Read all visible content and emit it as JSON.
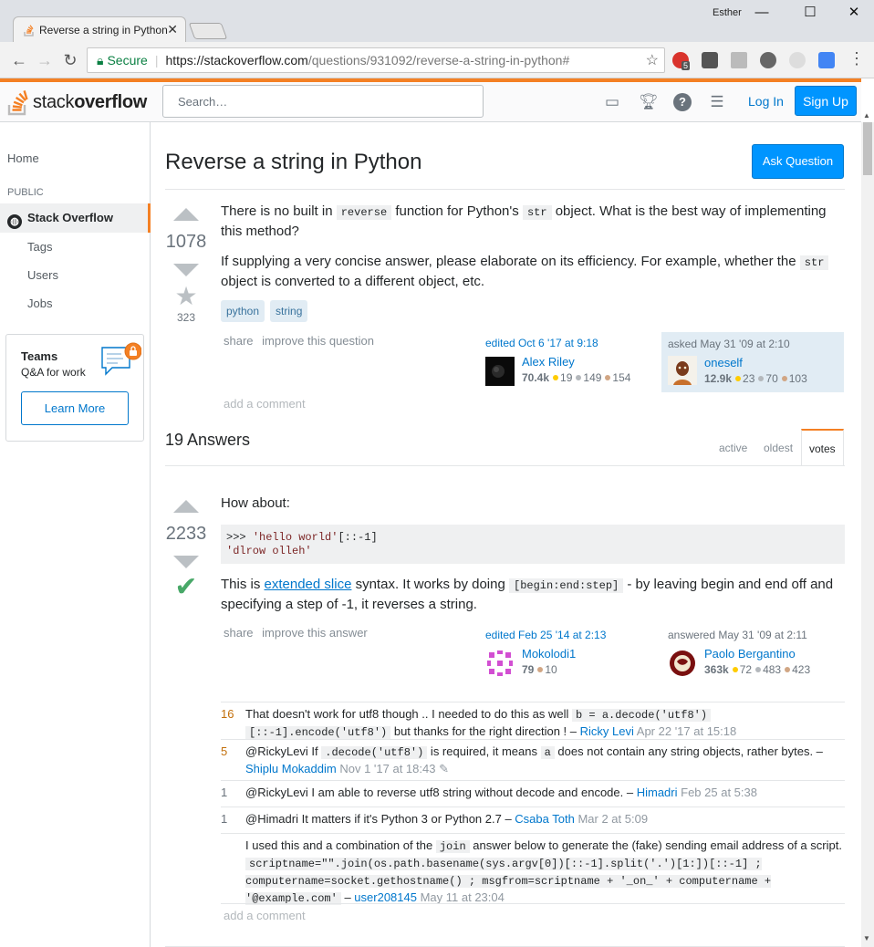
{
  "browser": {
    "tab_title": "Reverse a string in Python",
    "user": "Esther",
    "url_secure": "Secure",
    "url_host": "https://stackoverflow.com",
    "url_path": "/questions/931092/reverse-a-string-in-python#",
    "ext_badge": "5"
  },
  "header": {
    "logo_word_light": "stack",
    "logo_word_bold": "overflow",
    "search_placeholder": "Search…",
    "login": "Log In",
    "signup": "Sign Up"
  },
  "leftnav": {
    "home": "Home",
    "public": "PUBLIC",
    "stackoverflow": "Stack Overflow",
    "tags": "Tags",
    "users": "Users",
    "jobs": "Jobs",
    "teams_title": "Teams",
    "teams_sub": "Q&A for work",
    "learn_more": "Learn More"
  },
  "question": {
    "title": "Reverse a string in Python",
    "ask_button": "Ask Question",
    "votes": "1078",
    "favorites": "323",
    "p1_a": "There is no built in ",
    "p1_code1": "reverse",
    "p1_b": " function for Python's ",
    "p1_code2": "str",
    "p1_c": " object. What is the best way of implementing this method?",
    "p2_a": "If supplying a very concise answer, please elaborate on its efficiency. For example, whether the ",
    "p2_code": "str",
    "p2_b": " object is converted to a different object, etc.",
    "tags": [
      "python",
      "string"
    ],
    "share": "share",
    "improve": "improve this question",
    "edited_when": "edited Oct 6 '17 at 9:18",
    "editor": {
      "name": "Alex Riley",
      "rep": "70.4k",
      "gold": "19",
      "silver": "149",
      "bronze": "154"
    },
    "asked_when": "asked May 31 '09 at 2:10",
    "asker": {
      "name": "oneself",
      "rep": "12.9k",
      "gold": "23",
      "silver": "70",
      "bronze": "103"
    },
    "add_comment": "add a comment"
  },
  "answers": {
    "heading": "19 Answers",
    "sort_active": "active",
    "sort_oldest": "oldest",
    "sort_votes": "votes"
  },
  "answer1": {
    "votes": "2233",
    "intro": "How about:",
    "code_line1_prompt": ">>> ",
    "code_line1_str": "'hello world'",
    "code_line1_rest": "[::-1]",
    "code_line2": "'dlrow olleh'",
    "p_a": "This is ",
    "p_link": "extended slice",
    "p_b": " syntax. It works by doing ",
    "p_code": "[begin:end:step]",
    "p_c": " - by leaving begin and end off and specifying a step of -1, it reverses a string.",
    "share": "share",
    "improve": "improve this answer",
    "edited_when": "edited Feb 25 '14 at 2:13",
    "editor": {
      "name": "Mokolodi1",
      "rep": "79",
      "bronze": "10"
    },
    "answered_when": "answered May 31 '09 at 2:11",
    "answerer": {
      "name": "Paolo Bergantino",
      "rep": "363k",
      "gold": "72",
      "silver": "483",
      "bronze": "423"
    },
    "add_comment": "add a comment"
  },
  "comments": [
    {
      "score": "16",
      "t1": "That doesn't work for utf8 though .. I needed to do this as well ",
      "code1": "b = a.decode('utf8')",
      "code2": "[::-1].encode('utf8')",
      "t2": " but thanks for the right direction ! – ",
      "user": "Ricky Levi",
      "time": "Apr 22 '17 at 15:18"
    },
    {
      "score": "5",
      "t1": "@RickyLevi If ",
      "code1": ".decode('utf8')",
      "t2": " is required, it means ",
      "code2": "a",
      "t3": " does not contain any string objects, rather bytes. – ",
      "user": "Shiplu Mokaddim",
      "time": "Nov 1 '17 at 18:43"
    },
    {
      "score": "1",
      "t1": "@RickyLevi I am able to reverse utf8 string without decode and encode. – ",
      "user": "Himadri",
      "time": "Feb 25 at 5:38"
    },
    {
      "score": "1",
      "t1": "@Himadri It matters if it's Python 3 or Python 2.7 – ",
      "user": "Csaba Toth",
      "time": "Mar 2 at 5:09"
    },
    {
      "score": "",
      "t1": "I used this and a combination of the ",
      "code1": "join",
      "t2": " answer below to generate the (fake) sending email address of a script. ",
      "code2": "scriptname=\"\".join(os.path.basename(sys.argv[0])[::-1].split('.')[1:])[::-1] ; computername=socket.gethostname() ; msgfrom=scriptname + '_on_' + computername + '@example.com'",
      "t3": " – ",
      "user": "user208145",
      "time": "May 11 at 23:04"
    }
  ],
  "colors": {
    "accent": "#f48024",
    "link": "#0077cc",
    "button": "#0095ff",
    "accepted": "#48a868"
  }
}
